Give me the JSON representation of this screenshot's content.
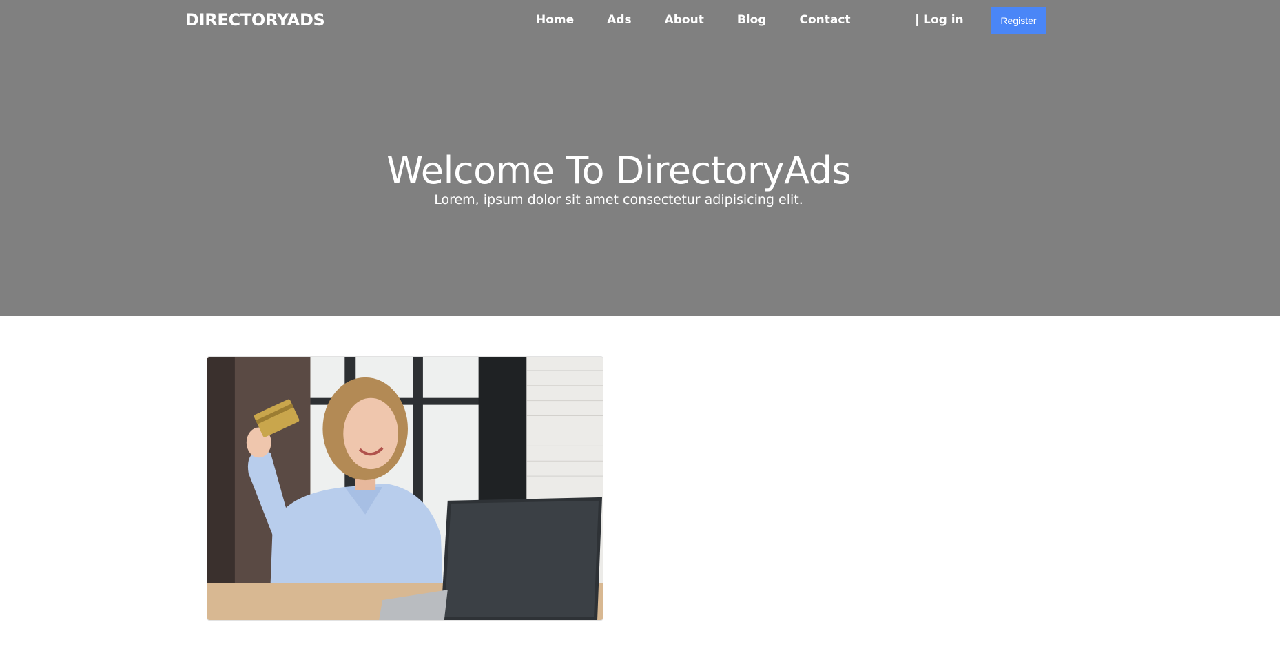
{
  "header": {
    "brand": "DIRECTORYADS",
    "nav": [
      {
        "label": "Home"
      },
      {
        "label": "Ads"
      },
      {
        "label": "About"
      },
      {
        "label": "Blog"
      },
      {
        "label": "Contact"
      }
    ],
    "login_label": "| Log in",
    "register_label": "Register",
    "register_color": "#4a86f7"
  },
  "hero": {
    "title": "Welcome To DirectoryAds",
    "subtitle": "Lorem, ipsum dolor sit amet consectetur adipisicing elit.",
    "background": "#808080"
  },
  "content": {
    "image_icon": "photo-woman-laptop-credit-card"
  }
}
